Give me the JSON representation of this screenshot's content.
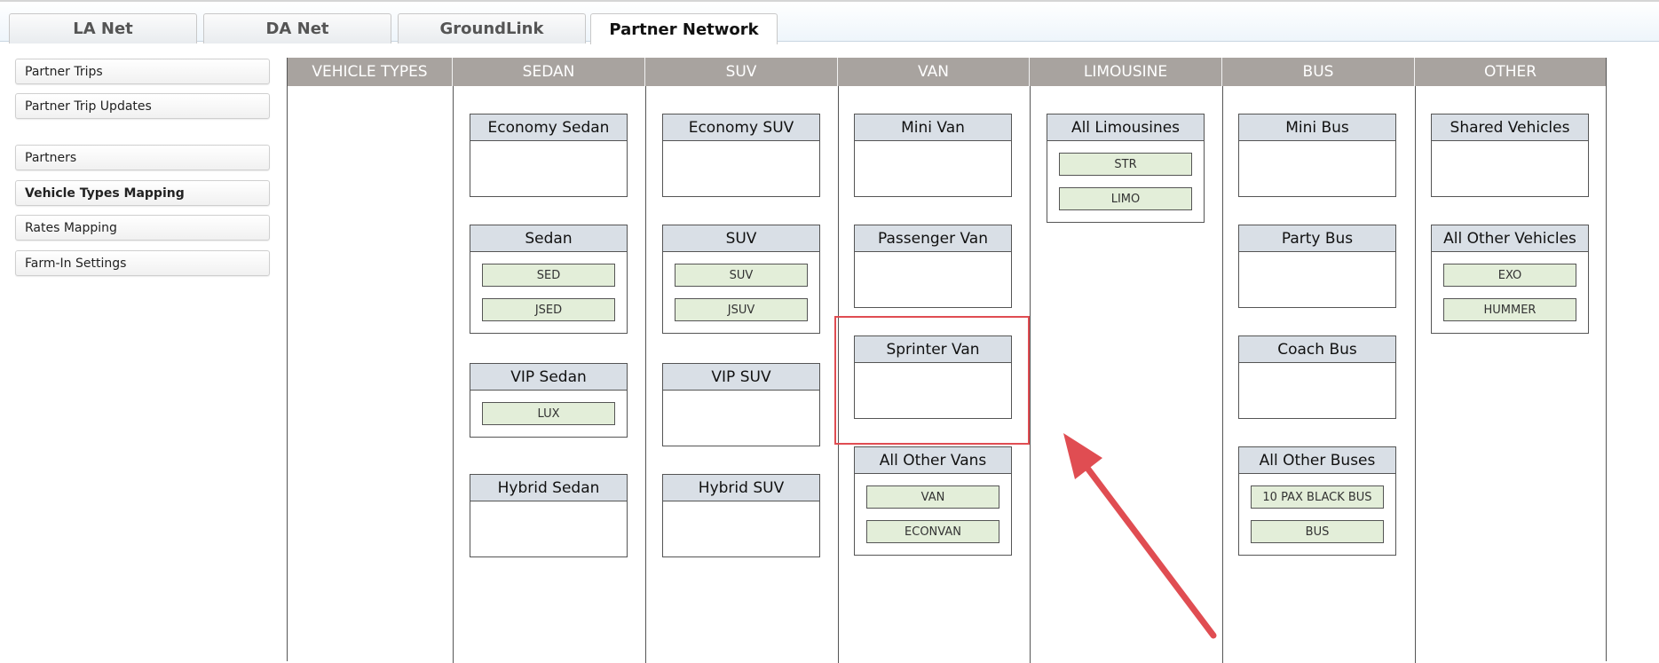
{
  "tabs": [
    {
      "label": "LA Net"
    },
    {
      "label": "DA Net"
    },
    {
      "label": "GroundLink"
    },
    {
      "label": "Partner Network"
    }
  ],
  "sidebar": {
    "items": [
      {
        "label": "Partner Trips"
      },
      {
        "label": "Partner Trip Updates"
      },
      {
        "label": "Partners"
      },
      {
        "label": "Vehicle Types Mapping"
      },
      {
        "label": "Rates Mapping"
      },
      {
        "label": "Farm-In Settings"
      }
    ]
  },
  "grid": {
    "headers": [
      "VEHICLE TYPES",
      "SEDAN",
      "SUV",
      "VAN",
      "LIMOUSINE",
      "BUS",
      "OTHER"
    ],
    "columns": {
      "sedan": [
        {
          "title": "Economy Sedan",
          "codes": []
        },
        {
          "title": "Sedan",
          "codes": [
            "SED",
            "JSED"
          ]
        },
        {
          "title": "VIP Sedan",
          "codes": [
            "LUX"
          ]
        },
        {
          "title": "Hybrid Sedan",
          "codes": []
        }
      ],
      "suv": [
        {
          "title": "Economy SUV",
          "codes": []
        },
        {
          "title": "SUV",
          "codes": [
            "SUV",
            "JSUV"
          ]
        },
        {
          "title": "VIP SUV",
          "codes": []
        },
        {
          "title": "Hybrid SUV",
          "codes": []
        }
      ],
      "van": [
        {
          "title": "Mini Van",
          "codes": []
        },
        {
          "title": "Passenger Van",
          "codes": []
        },
        {
          "title": "Sprinter Van",
          "codes": []
        },
        {
          "title": "All Other Vans",
          "codes": [
            "VAN",
            "ECONVAN"
          ]
        }
      ],
      "limousine": [
        {
          "title": "All Limousines",
          "codes": [
            "STR",
            "LIMO"
          ]
        }
      ],
      "bus": [
        {
          "title": "Mini Bus",
          "codes": []
        },
        {
          "title": "Party Bus",
          "codes": []
        },
        {
          "title": "Coach Bus",
          "codes": []
        },
        {
          "title": "All Other Buses",
          "codes": [
            "10 PAX BLACK BUS",
            "BUS"
          ]
        }
      ],
      "other": [
        {
          "title": "Shared Vehicles",
          "codes": []
        },
        {
          "title": "All Other Vehicles",
          "codes": [
            "EXO",
            "HUMMER"
          ]
        }
      ]
    }
  },
  "colors": {
    "header_bg": "#a8a39f",
    "card_title_bg": "#d9dfe6",
    "code_bg": "#e3eed9",
    "annotation_red": "#e04d52"
  }
}
